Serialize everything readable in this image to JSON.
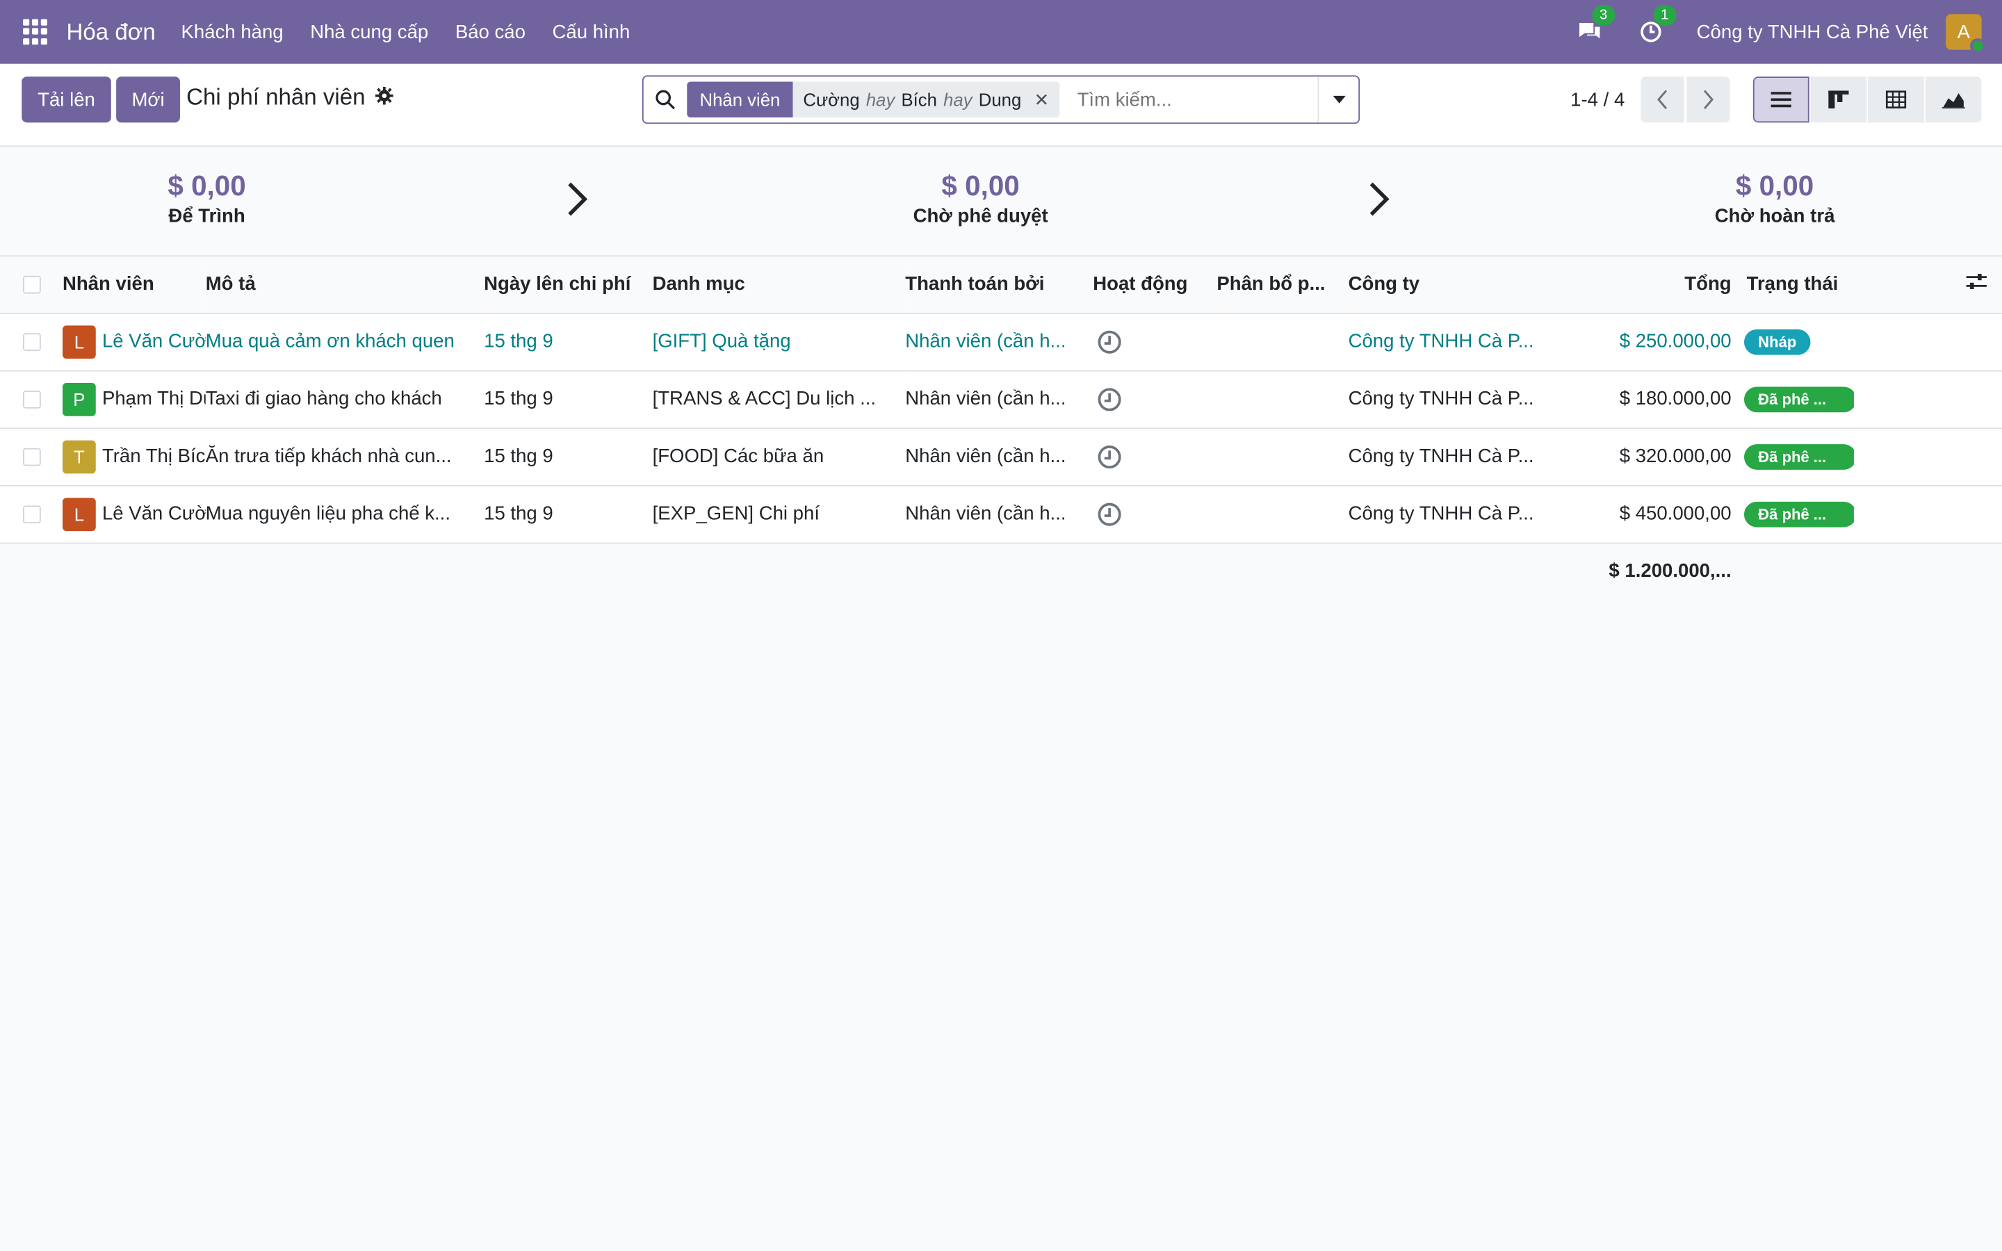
{
  "navbar": {
    "brand": "Hóa đơn",
    "menu": [
      "Khách hàng",
      "Nhà cung cấp",
      "Báo cáo",
      "Cấu hình"
    ],
    "messages_count": "3",
    "activities_count": "1",
    "company": "Công ty TNHH Cà Phê Việt",
    "avatar_letter": "A"
  },
  "control": {
    "upload_label": "Tải lên",
    "new_label": "Mới",
    "title": "Chi phí nhân viên",
    "search": {
      "facet_name": "Nhân viên",
      "facet_values": [
        "Cường",
        "Bích",
        "Dung"
      ],
      "facet_separator": "hay",
      "placeholder": "Tìm kiếm..."
    },
    "pager": "1-4 / 4"
  },
  "stages": [
    {
      "amount": "$ 0,00",
      "label": "Để Trình"
    },
    {
      "amount": "$ 0,00",
      "label": "Chờ phê duyệt"
    },
    {
      "amount": "$ 0,00",
      "label": "Chờ hoàn trả"
    }
  ],
  "table": {
    "headers": {
      "employee": "Nhân viên",
      "description": "Mô tả",
      "date": "Ngày lên chi phí",
      "category": "Danh mục",
      "paid_by": "Thanh toán bởi",
      "activity": "Hoạt động",
      "analytic": "Phân bổ p...",
      "company": "Công ty",
      "total": "Tổng",
      "status": "Trạng thái"
    },
    "rows": [
      {
        "initial": "L",
        "initial_color": "#c4501f",
        "employee": "Lê Văn Cường",
        "description": "Mua quà cảm ơn khách quen",
        "date": "15 thg 9",
        "category": "[GIFT] Quà tặng",
        "paid_by": "Nhân viên (cần h...",
        "company": "Công ty TNHH Cà P...",
        "total": "$ 250.000,00",
        "status": "Nháp",
        "status_color": "#17a2b8",
        "highlight": true
      },
      {
        "initial": "P",
        "initial_color": "#28a745",
        "employee": "Phạm Thị Dung",
        "description": "Taxi đi giao hàng cho khách",
        "date": "15 thg 9",
        "category": "[TRANS & ACC] Du lịch ...",
        "paid_by": "Nhân viên (cần h...",
        "company": "Công ty TNHH Cà P...",
        "total": "$ 180.000,00",
        "status": "Đã phê ...",
        "status_color": "#28a745",
        "highlight": false
      },
      {
        "initial": "T",
        "initial_color": "#c2a32f",
        "employee": "Trần Thị Bích",
        "description": "Ăn trưa tiếp khách nhà cun...",
        "date": "15 thg 9",
        "category": "[FOOD] Các bữa ăn",
        "paid_by": "Nhân viên (cần h...",
        "company": "Công ty TNHH Cà P...",
        "total": "$ 320.000,00",
        "status": "Đã phê ...",
        "status_color": "#28a745",
        "highlight": false
      },
      {
        "initial": "L",
        "initial_color": "#c4501f",
        "employee": "Lê Văn Cường",
        "description": "Mua nguyên liệu pha chế k...",
        "date": "15 thg 9",
        "category": "[EXP_GEN] Chi phí",
        "paid_by": "Nhân viên (cần h...",
        "company": "Công ty TNHH Cà P...",
        "total": "$ 450.000,00",
        "status": "Đã phê ...",
        "status_color": "#28a745",
        "highlight": false
      }
    ],
    "grand_total": "$ 1.200.000,..."
  },
  "colors": {
    "primary": "#71639e",
    "link": "#017e84",
    "success": "#28a745",
    "info": "#17a2b8"
  }
}
